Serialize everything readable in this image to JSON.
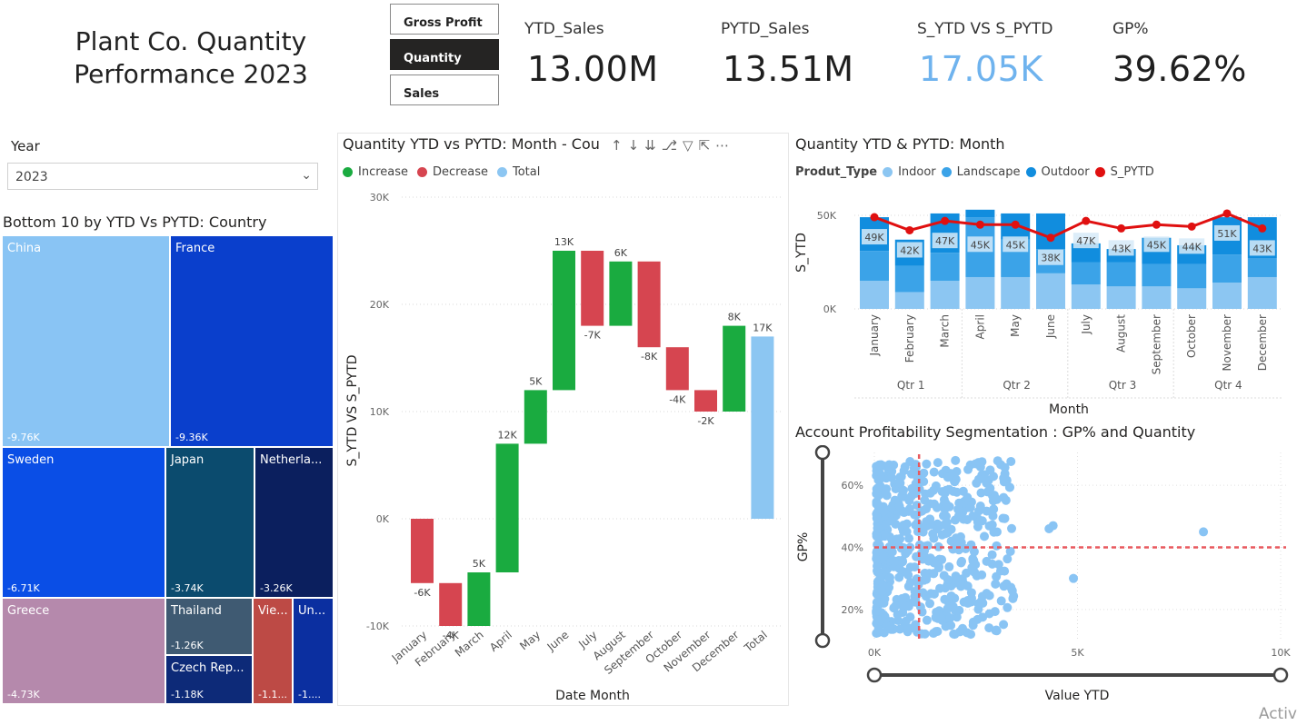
{
  "header": {
    "title": "Plant Co. Quantity Performance 2023",
    "buttons": [
      {
        "label": "Gross Profit",
        "active": false
      },
      {
        "label": "Quantity",
        "active": true
      },
      {
        "label": "Sales",
        "active": false
      }
    ]
  },
  "kpis": [
    {
      "label": "YTD_Sales",
      "value": "13.00M",
      "color": "#1f1f1f"
    },
    {
      "label": "PYTD_Sales",
      "value": "13.51M",
      "color": "#1f1f1f"
    },
    {
      "label": "S_YTD VS S_PYTD",
      "value": "17.05K",
      "color": "#6fb3ee"
    },
    {
      "label": "GP%",
      "value": "39.62%",
      "color": "#1f1f1f"
    }
  ],
  "slicer": {
    "label": "Year",
    "value": "2023"
  },
  "treemap": {
    "title": "Bottom 10 by YTD Vs PYTD: Country",
    "cells": [
      {
        "name": "China",
        "value": "-9.76K",
        "color": "#89c4f4"
      },
      {
        "name": "France",
        "value": "-9.36K",
        "color": "#0a3fcc"
      },
      {
        "name": "Sweden",
        "value": "-6.71K",
        "color": "#0a4ee6"
      },
      {
        "name": "Japan",
        "value": "-3.74K",
        "color": "#0b4b6e"
      },
      {
        "name": "Netherla...",
        "value": "-3.26K",
        "color": "#0b1f5e"
      },
      {
        "name": "Greece",
        "value": "-4.73K",
        "color": "#b589ac"
      },
      {
        "name": "Thailand",
        "value": "-1.26K",
        "color": "#3f5a72"
      },
      {
        "name": "Czech Rep...",
        "value": "-1.18K",
        "color": "#0d2a78"
      },
      {
        "name": "Vie...",
        "value": "-1.1...",
        "color": "#bd4a45"
      },
      {
        "name": "Un...",
        "value": "-1....",
        "color": "#0b2fa0"
      }
    ]
  },
  "waterfall": {
    "title": "Quantity YTD vs PYTD: Month - Cou",
    "legend": [
      {
        "label": "Increase",
        "color": "#1aab40"
      },
      {
        "label": "Decrease",
        "color": "#d64550"
      },
      {
        "label": "Total",
        "color": "#8cc6f2"
      }
    ],
    "xlabel": "Date Month",
    "ylabel": "S_YTD VS S_PYTD",
    "yticks": [
      "30K",
      "20K",
      "10K",
      "0K",
      "-10K"
    ]
  },
  "combo": {
    "title": "Quantity YTD & PYTD: Month",
    "legend_title": "Produt_Type",
    "legend": [
      {
        "label": "Indoor",
        "color": "#8cc6f2"
      },
      {
        "label": "Landscape",
        "color": "#3ba3e8"
      },
      {
        "label": "Outdoor",
        "color": "#118dde"
      },
      {
        "label": "S_PYTD",
        "color": "#e01010"
      }
    ],
    "xlabel": "Month",
    "ylabel": "S_YTD",
    "yticks": [
      "50K",
      "0K"
    ],
    "quarters": [
      "Qtr 1",
      "Qtr 2",
      "Qtr 3",
      "Qtr 4"
    ]
  },
  "scatter": {
    "title": "Account Profitability Segmentation : GP% and Quantity",
    "xlabel": "Value YTD",
    "ylabel": "GP%",
    "xticks": [
      "0K",
      "5K",
      "10K"
    ],
    "yticks": [
      "60%",
      "40%",
      "20%"
    ]
  },
  "watermark": "Activ",
  "chart_data": [
    {
      "type": "bar",
      "subtype": "waterfall",
      "title": "Quantity YTD vs PYTD: Month - Cou",
      "xlabel": "Date Month",
      "ylabel": "S_YTD VS S_PYTD",
      "ylim": [
        -10000,
        30000
      ],
      "categories": [
        "January",
        "February",
        "March",
        "April",
        "May",
        "June",
        "July",
        "August",
        "September",
        "October",
        "November",
        "December",
        "Total"
      ],
      "values": [
        -6000,
        -4000,
        5000,
        12000,
        5000,
        13000,
        -7000,
        6000,
        -8000,
        -4000,
        -2000,
        8000,
        17000
      ],
      "data_labels": [
        "-6K",
        "-4K",
        "5K",
        "12K",
        "5K",
        "13K",
        "-7K",
        "6K",
        "-8K",
        "-4K",
        "-2K",
        "8K",
        "17K"
      ]
    },
    {
      "type": "bar",
      "subtype": "stacked-column-with-line",
      "title": "Quantity YTD & PYTD: Month",
      "xlabel": "Month",
      "ylabel": "S_YTD",
      "ylim": [
        0,
        50000
      ],
      "categories": [
        "January",
        "February",
        "March",
        "April",
        "May",
        "June",
        "July",
        "August",
        "September",
        "October",
        "November",
        "December"
      ],
      "series": [
        {
          "name": "Indoor",
          "values": [
            15000,
            9000,
            15000,
            17000,
            17000,
            19000,
            13000,
            12000,
            12000,
            11000,
            14000,
            17000
          ]
        },
        {
          "name": "Landscape",
          "values": [
            16000,
            14000,
            15000,
            32000,
            20000,
            13000,
            12000,
            13000,
            12000,
            13000,
            15000,
            10000
          ]
        },
        {
          "name": "Outdoor",
          "values": [
            18000,
            14000,
            21000,
            4000,
            14000,
            19000,
            10000,
            7000,
            14000,
            10000,
            20000,
            22000
          ]
        },
        {
          "name": "S_PYTD",
          "values": [
            49000,
            42000,
            47000,
            45000,
            45000,
            38000,
            47000,
            43000,
            45000,
            44000,
            51000,
            43000
          ]
        }
      ],
      "data_labels": [
        "49K",
        "42K",
        "47K",
        "45K",
        "45K",
        "38K",
        "47K",
        "43K",
        "45K",
        "44K",
        "51K",
        "43K"
      ]
    },
    {
      "type": "scatter",
      "title": "Account Profitability Segmentation : GP% and Quantity",
      "xlabel": "Value YTD",
      "ylabel": "GP%",
      "xlim": [
        0,
        10000
      ],
      "ylim": [
        10,
        70
      ],
      "reference_lines": {
        "x": 1100,
        "y": 40
      },
      "outliers": [
        [
          4400,
          47
        ],
        [
          4300,
          46
        ],
        [
          4900,
          30
        ],
        [
          8100,
          45
        ]
      ]
    }
  ]
}
